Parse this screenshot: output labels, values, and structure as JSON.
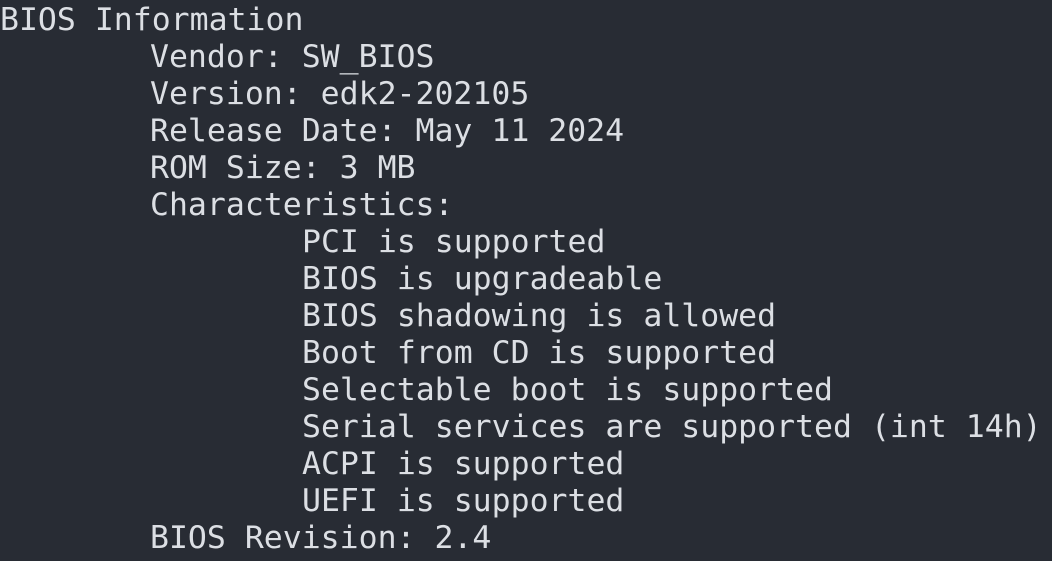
{
  "terminal": {
    "section_title": "BIOS Information",
    "vendor": "Vendor: SW_BIOS",
    "version": "Version: edk2-202105",
    "release_date": "Release Date: May 11 2024",
    "rom_size": "ROM Size: 3 MB",
    "characteristics_label": "Characteristics:",
    "characteristics": [
      "PCI is supported",
      "BIOS is upgradeable",
      "BIOS shadowing is allowed",
      "Boot from CD is supported",
      "Selectable boot is supported",
      "Serial services are supported (int 14h)",
      "ACPI is supported",
      "UEFI is supported"
    ],
    "bios_revision": "BIOS Revision: 2.4"
  },
  "colors": {
    "background": "#282c34",
    "foreground": "#dcdfe4"
  }
}
